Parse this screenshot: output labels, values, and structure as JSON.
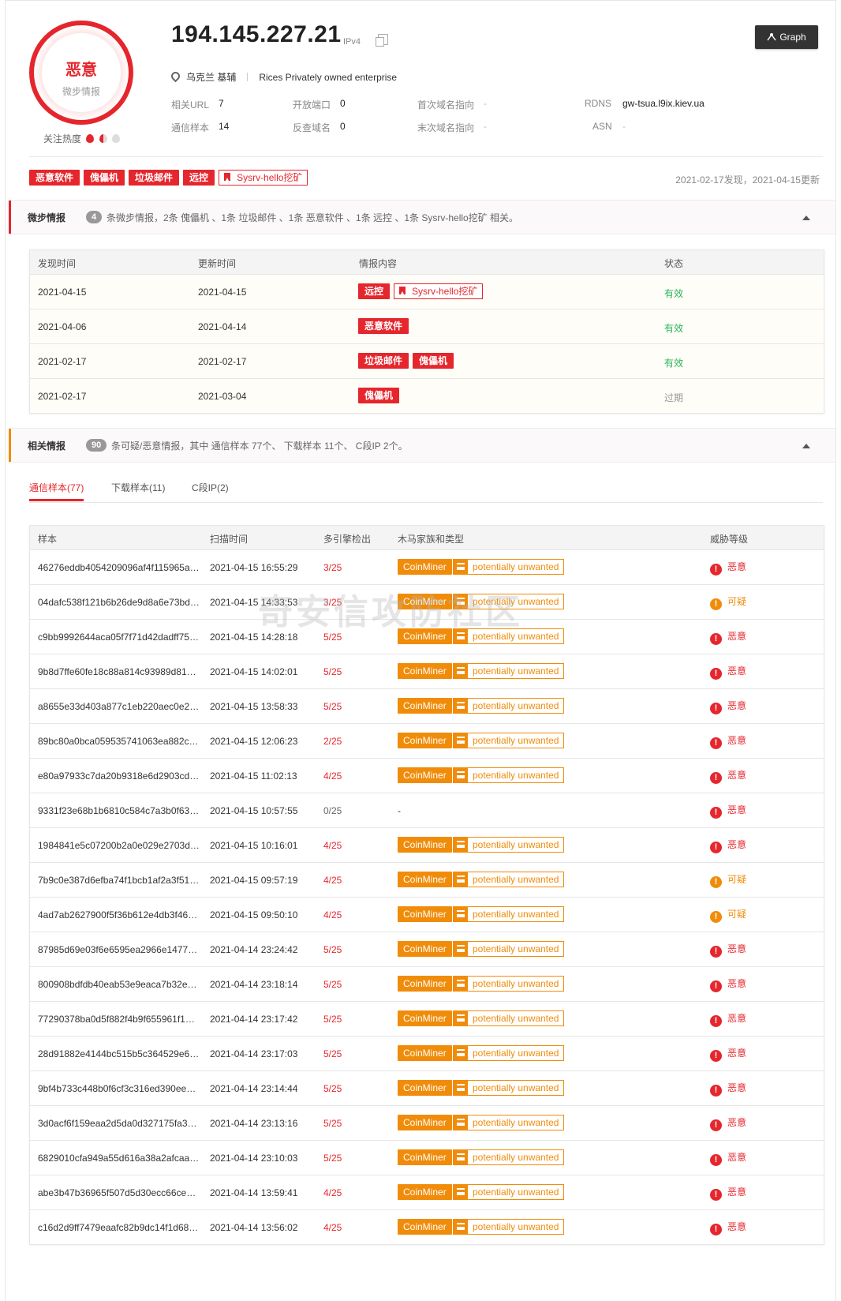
{
  "verdict": {
    "title": "恶意",
    "subtitle": "微步情报"
  },
  "heat_label": "关注热度",
  "ip": "194.145.227.21",
  "ip_version": "IPv4",
  "graph_button": "Graph",
  "location": "乌克兰 基辅",
  "owner": "Rices Privately owned enterprise",
  "info": [
    {
      "key": "相关URL",
      "value": "7"
    },
    {
      "key": "开放端口",
      "value": "0"
    },
    {
      "key": "首次域名指向",
      "value": "-"
    },
    {
      "key": "RDNS",
      "value": "gw-tsua.l9ix.kiev.ua"
    },
    {
      "key": "通信样本",
      "value": "14"
    },
    {
      "key": "反查域名",
      "value": "0"
    },
    {
      "key": "末次域名指向",
      "value": "-"
    },
    {
      "key": "ASN",
      "value": "-"
    }
  ],
  "tags": [
    "恶意软件",
    "傀儡机",
    "垃圾邮件",
    "远控"
  ],
  "outline_tag": "Sysrv-hello挖矿",
  "dates": "2021-02-17发现，2021-04-15更新",
  "section1": {
    "title": "微步情报",
    "count": "4",
    "desc": "条微步情报，2条 傀儡机 、1条 垃圾邮件 、1条 恶意软件 、1条 远控 、1条 Sysrv-hello挖矿 相关。"
  },
  "table1": {
    "headers": [
      "发现时间",
      "更新时间",
      "情报内容",
      "状态"
    ],
    "rows": [
      {
        "found": "2021-04-15",
        "updated": "2021-04-15",
        "tags": [
          "远控"
        ],
        "outline": "Sysrv-hello挖矿",
        "status": "有效"
      },
      {
        "found": "2021-04-06",
        "updated": "2021-04-14",
        "tags": [
          "恶意软件"
        ],
        "outline": "",
        "status": "有效"
      },
      {
        "found": "2021-02-17",
        "updated": "2021-02-17",
        "tags": [
          "垃圾邮件",
          "傀儡机"
        ],
        "outline": "",
        "status": "有效"
      },
      {
        "found": "2021-02-17",
        "updated": "2021-03-04",
        "tags": [
          "傀儡机"
        ],
        "outline": "",
        "status": "过期"
      }
    ]
  },
  "section2": {
    "title": "相关情报",
    "count": "90",
    "desc": "条可疑/恶意情报，其中 通信样本 77个、 下载样本 11个、 C段IP 2个。"
  },
  "tabs": [
    "通信样本(77)",
    "下载样本(11)",
    "C段IP(2)"
  ],
  "table2": {
    "headers": [
      "样本",
      "扫描时间",
      "多引擎检出",
      "木马家族和类型",
      "威胁等级"
    ],
    "family_label": "CoinMiner",
    "type_label": "potentially unwanted",
    "rows": [
      {
        "hash": "46276eddb4054209096af4f115965ae...",
        "time": "2021-04-15 16:55:29",
        "det": "3/25",
        "fam": true,
        "level": "恶意"
      },
      {
        "hash": "04dafc538f121b6b26de9d8a6e73bd8...",
        "time": "2021-04-15 14:33:53",
        "det": "3/25",
        "fam": true,
        "level": "可疑"
      },
      {
        "hash": "c9bb9992644aca05f7f71d42dadff758...",
        "time": "2021-04-15 14:28:18",
        "det": "5/25",
        "fam": true,
        "level": "恶意"
      },
      {
        "hash": "9b8d7ffe60fe18c88a814c93989d81d6...",
        "time": "2021-04-15 14:02:01",
        "det": "5/25",
        "fam": true,
        "level": "恶意"
      },
      {
        "hash": "a8655e33d403a877c1eb220aec0e28...",
        "time": "2021-04-15 13:58:33",
        "det": "5/25",
        "fam": true,
        "level": "恶意"
      },
      {
        "hash": "89bc80a0bca059535741063ea882c1...",
        "time": "2021-04-15 12:06:23",
        "det": "2/25",
        "fam": true,
        "level": "恶意"
      },
      {
        "hash": "e80a97933c7da20b9318e6d2903cdf4...",
        "time": "2021-04-15 11:02:13",
        "det": "4/25",
        "fam": true,
        "level": "恶意"
      },
      {
        "hash": "9331f23e68b1b6810c584c7a3b0f636...",
        "time": "2021-04-15 10:57:55",
        "det": "0/25",
        "fam": false,
        "level": "恶意"
      },
      {
        "hash": "1984841e5c07200b2a0e029e2703da...",
        "time": "2021-04-15 10:16:01",
        "det": "4/25",
        "fam": true,
        "level": "恶意"
      },
      {
        "hash": "7b9c0e387d6efba74f1bcb1af2a3f51a...",
        "time": "2021-04-15 09:57:19",
        "det": "4/25",
        "fam": true,
        "level": "可疑"
      },
      {
        "hash": "4ad7ab2627900f5f36b612e4db3f46c8...",
        "time": "2021-04-15 09:50:10",
        "det": "4/25",
        "fam": true,
        "level": "可疑"
      },
      {
        "hash": "87985d69e03f6e6595ea2966e1477a0...",
        "time": "2021-04-14 23:24:42",
        "det": "5/25",
        "fam": true,
        "level": "恶意"
      },
      {
        "hash": "800908bdfdb40eab53e9eaca7b32ed5...",
        "time": "2021-04-14 23:18:14",
        "det": "5/25",
        "fam": true,
        "level": "恶意"
      },
      {
        "hash": "77290378ba0d5f882f4b9f655961f19a...",
        "time": "2021-04-14 23:17:42",
        "det": "5/25",
        "fam": true,
        "level": "恶意"
      },
      {
        "hash": "28d91882e4144bc515b5c364529e68f...",
        "time": "2021-04-14 23:17:03",
        "det": "5/25",
        "fam": true,
        "level": "恶意"
      },
      {
        "hash": "9bf4b733c448b0f6cf3c316ed390ee6a...",
        "time": "2021-04-14 23:14:44",
        "det": "5/25",
        "fam": true,
        "level": "恶意"
      },
      {
        "hash": "3d0acf6f159eaa2d5da0d327175fa3c6...",
        "time": "2021-04-14 23:13:16",
        "det": "5/25",
        "fam": true,
        "level": "恶意"
      },
      {
        "hash": "6829010cfa949a55d616a38a2afcaa6...",
        "time": "2021-04-14 23:10:03",
        "det": "5/25",
        "fam": true,
        "level": "恶意"
      },
      {
        "hash": "abe3b47b36965f507d5d30ecc66cea0...",
        "time": "2021-04-14 13:59:41",
        "det": "4/25",
        "fam": true,
        "level": "恶意"
      },
      {
        "hash": "c16d2d9ff7479eaafc82b9dc14f1d688...",
        "time": "2021-04-14 13:56:02",
        "det": "4/25",
        "fam": true,
        "level": "恶意"
      }
    ]
  },
  "watermark": "奇安信攻防社区",
  "colors": {
    "danger": "#e5262d",
    "warning": "#f08c0a",
    "valid": "#2db35d",
    "dark_button": "#333333"
  }
}
